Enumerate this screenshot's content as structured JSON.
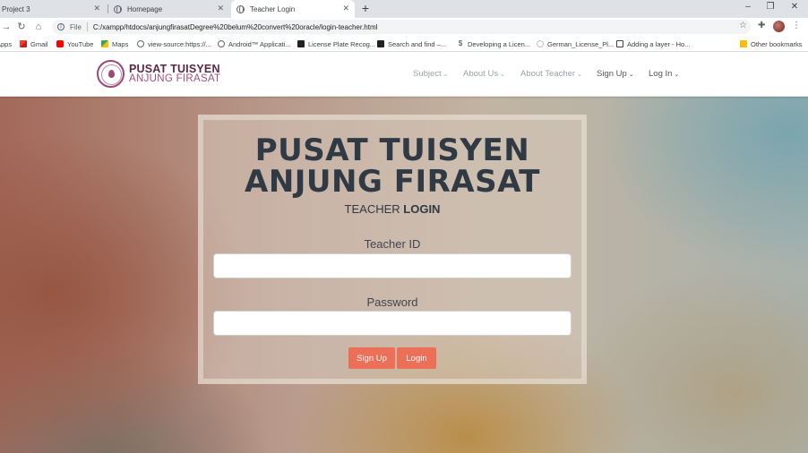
{
  "browser": {
    "tabs": [
      {
        "label": "Project 3",
        "active": false
      },
      {
        "label": "Homepage",
        "active": false
      },
      {
        "label": "Teacher Login",
        "active": true
      }
    ],
    "new_tab_symbol": "+",
    "window_controls": {
      "minimize": "–",
      "restore": "❐",
      "close": "✕"
    },
    "omnibox": {
      "scheme": "File",
      "url": "C:/xampp/htdocs/anjungfirasatDegree%20belum%20convert%20oracle/login-teacher.html"
    },
    "bookmarks": [
      {
        "label": "Apps",
        "icon": "apps-icon"
      },
      {
        "label": "Gmail",
        "icon": "gmail-icon"
      },
      {
        "label": "YouTube",
        "icon": "youtube-icon"
      },
      {
        "label": "Maps",
        "icon": "maps-icon"
      },
      {
        "label": "view-source:https://...",
        "icon": "globe-icon"
      },
      {
        "label": "Android™ Applicati...",
        "icon": "globe-icon"
      },
      {
        "label": "License Plate Recog...",
        "icon": "page-icon"
      },
      {
        "label": "Search and find –...",
        "icon": "page-icon"
      },
      {
        "label": "Developing a Licen...",
        "icon": "dollar-icon"
      },
      {
        "label": "German_License_Pl...",
        "icon": "page-icon"
      },
      {
        "label": "Adding a layer - Ho...",
        "icon": "page-icon"
      },
      {
        "label": "Other bookmarks",
        "icon": "folder-icon"
      }
    ]
  },
  "site": {
    "logo": {
      "title": "PUSAT TUISYEN",
      "subtitle": "ANJUNG FIRASAT"
    },
    "menu": [
      {
        "label": "Subject"
      },
      {
        "label": "About Us"
      },
      {
        "label": "About Teacher"
      },
      {
        "label": "Sign Up"
      },
      {
        "label": "Log In"
      }
    ],
    "caret": "⌄"
  },
  "login": {
    "heading_line1": "PUSAT TUISYEN",
    "heading_line2": "ANJUNG FIRASAT",
    "subtitle_a": "TEACHER",
    "subtitle_b": "LOGIN",
    "teacher_id_label": "Teacher ID",
    "teacher_id_value": "",
    "password_label": "Password",
    "password_value": "",
    "signup_button": "Sign Up",
    "login_button": "Login"
  },
  "colors": {
    "button": "#ec6f57",
    "heading": "#2f3a44",
    "logo_primary": "#5a2a45",
    "logo_secondary": "#a0507c"
  }
}
